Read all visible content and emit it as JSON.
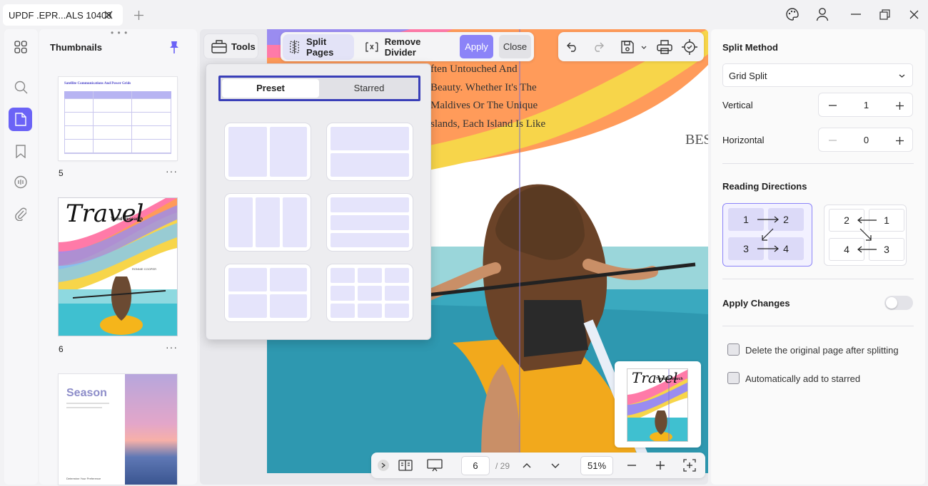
{
  "tab": {
    "title": "UPDF .EPR...ALS 10408"
  },
  "thumbnails": {
    "title": "Thumbnails",
    "pages": [
      {
        "number": "5",
        "heading": "Satellite Communications And Power Grids"
      },
      {
        "number": "6",
        "heading": "Travel",
        "subheading": "Trend Research",
        "byline": "RONNIE COOPER"
      },
      {
        "number": "",
        "heading": "Season",
        "footer": "Determine Your Preference"
      }
    ]
  },
  "toolbar": {
    "tools_label": "Tools",
    "split_pages_label": "Split Pages",
    "remove_divider_label": "Remove Divider",
    "apply_label": "Apply",
    "close_label": "Close"
  },
  "preset_popup": {
    "tab_preset": "Preset",
    "tab_starred": "Starred",
    "active_tab": "Preset"
  },
  "document": {
    "lines": [
      "ften Untouched And",
      "Beauty. Whether It's The",
      "Maldives Or The Unique",
      "slands, Each Island Is Like"
    ],
    "side_word": "BES",
    "mini_title": "Travel",
    "mini_subtitle": "Trend Research"
  },
  "bottom_bar": {
    "current_page": "6",
    "total_pages": "/ 29",
    "zoom": "51%"
  },
  "right_panel": {
    "split_method_title": "Split Method",
    "split_method_value": "Grid Split",
    "vertical_label": "Vertical",
    "vertical_value": "1",
    "horizontal_label": "Horizontal",
    "horizontal_value": "0",
    "reading_directions_title": "Reading Directions",
    "direction_a": [
      "1",
      "2",
      "3",
      "4"
    ],
    "direction_b": [
      "2",
      "1",
      "4",
      "3"
    ],
    "apply_changes_label": "Apply Changes",
    "apply_changes_on": false,
    "delete_original_label": "Delete the original page after splitting",
    "auto_starred_label": "Automatically add to starred"
  },
  "colors": {
    "accent": "#6b63f6",
    "accent_dark": "#3a3fb8",
    "selected_cell": "#e5e4fb"
  }
}
